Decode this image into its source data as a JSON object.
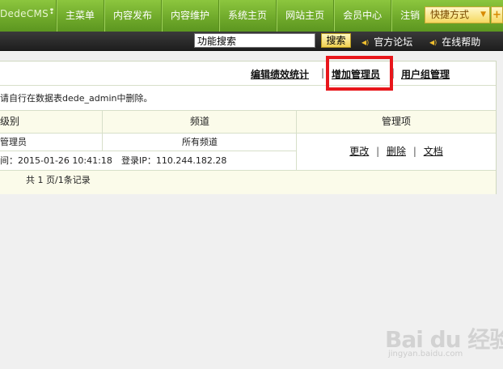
{
  "topnav": {
    "brand": "DedeCMS",
    "brand_mark": "❢",
    "items": [
      {
        "label": "主菜单"
      },
      {
        "label": "内容发布"
      },
      {
        "label": "内容维护"
      },
      {
        "label": "系统主页"
      },
      {
        "label": "网站主页"
      },
      {
        "label": "会员中心"
      },
      {
        "label": "注销"
      }
    ],
    "quick_label": "快捷方式",
    "quick_plus": "+"
  },
  "subbar": {
    "search_value": "功能搜索",
    "search_button": "搜索",
    "forum_link": "官方论坛",
    "help_link": "在线帮助"
  },
  "toolbar": {
    "stats_link": "编辑绩效统计",
    "add_admin_link": "增加管理员",
    "group_link": "用户组管理",
    "separator": "|"
  },
  "notice": "请自行在数据表dede_admin中删除。",
  "table": {
    "headers": [
      "级别",
      "频道",
      "管理项"
    ],
    "row": {
      "level": "管理员",
      "channel": "所有频道",
      "time_label": "间：2015-01-26 10:41:18",
      "ip_label": "登录IP：110.244.182.28"
    },
    "actions": [
      "更改",
      "删除",
      "文档"
    ],
    "action_separator": "|"
  },
  "footer": "共 1 页/1条记录",
  "watermark": {
    "text": "Bai du 经验",
    "url": "jingyan.baidu.com"
  },
  "colors": {
    "nav_green": "#6ea82a",
    "subbar_dark": "#2a2a2a",
    "highlight_red": "#e8161b",
    "header_yellow": "#fbfbea"
  }
}
